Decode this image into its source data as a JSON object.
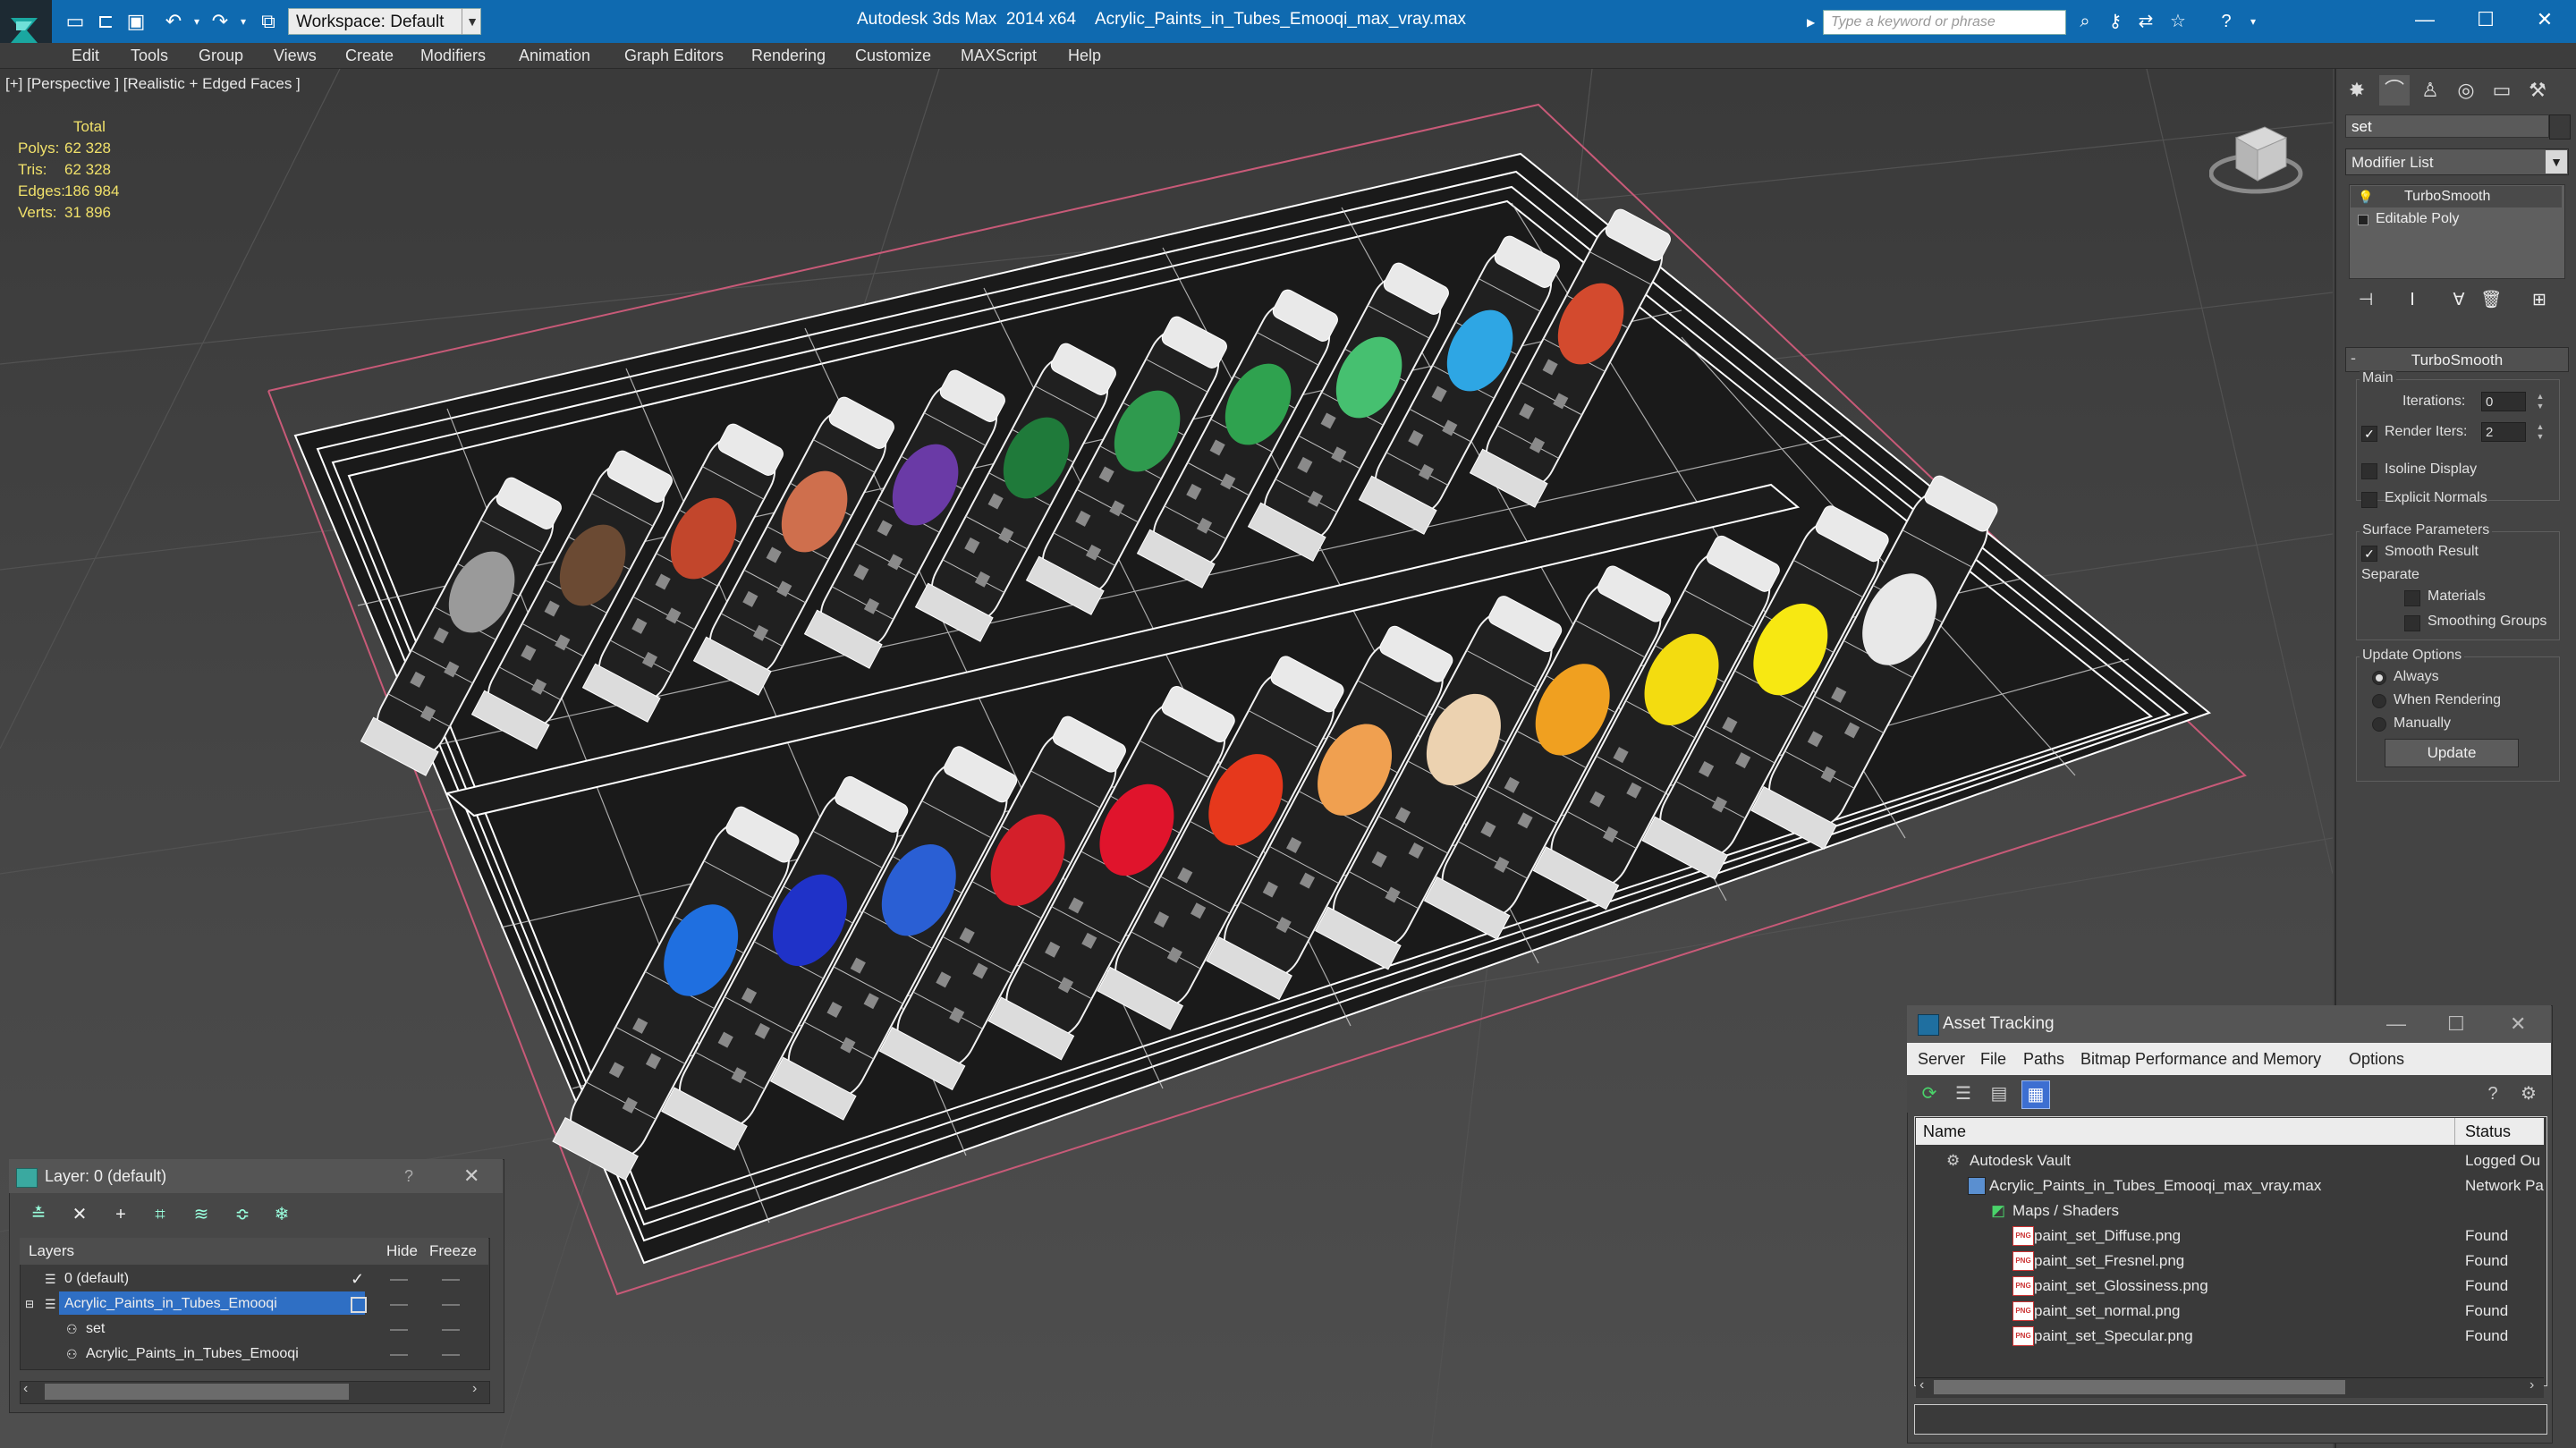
{
  "titlebar": {
    "workspace": "Workspace: Default",
    "app_title": "Autodesk 3ds Max  2014 x64",
    "file_title": "Acrylic_Paints_in_Tubes_Emooqi_max_vray.max",
    "search_placeholder": "Type a keyword or phrase"
  },
  "menu": [
    "Edit",
    "Tools",
    "Group",
    "Views",
    "Create",
    "Modifiers",
    "Animation",
    "Graph Editors",
    "Rendering",
    "Customize",
    "MAXScript",
    "Help"
  ],
  "viewport": {
    "label": "[+] [Perspective ] [Realistic + Edged Faces ]",
    "stats": {
      "header": "Total",
      "rows": [
        {
          "label": "Polys:",
          "value": "62 328"
        },
        {
          "label": "Tris:",
          "value": "62 328"
        },
        {
          "label": "Edges:",
          "value": "186 984"
        },
        {
          "label": "Verts:",
          "value": "31 896"
        }
      ]
    },
    "tube_colors_back": [
      "#9a9a9a",
      "#6b4a33",
      "#c2462c",
      "#cf6f4d",
      "#6a3aa6",
      "#1f7a3a",
      "#2f9a4e",
      "#2fa24f",
      "#46c070",
      "#2ea6e4",
      "#d34a2e"
    ],
    "tube_colors_front": [
      "#1f6fe0",
      "#1f32c8",
      "#2a5fd4",
      "#d41f2a",
      "#e0142c",
      "#e6381c",
      "#f0a050",
      "#ecd2b0",
      "#f0a020",
      "#f3dc10",
      "#f7e812",
      "#e8e8e8"
    ]
  },
  "command_panel": {
    "object_name": "set",
    "modifier_list": "Modifier List",
    "stack": [
      "TurboSmooth",
      "Editable Poly"
    ],
    "rollout_title": "TurboSmooth",
    "main_label": "Main",
    "iterations_label": "Iterations:",
    "iterations_value": "0",
    "render_iters_label": "Render Iters:",
    "render_iters_value": "2",
    "isoline_label": "Isoline Display",
    "explicit_normals_label": "Explicit Normals",
    "surface_params_label": "Surface Parameters",
    "smooth_result_label": "Smooth Result",
    "separate_label": "Separate",
    "materials_label": "Materials",
    "smoothing_groups_label": "Smoothing Groups",
    "update_options_label": "Update Options",
    "always_label": "Always",
    "when_rendering_label": "When Rendering",
    "manually_label": "Manually",
    "update_button": "Update"
  },
  "layer_panel": {
    "title": "Layer: 0 (default)",
    "help": "?",
    "columns": {
      "layers": "Layers",
      "hide": "Hide",
      "freeze": "Freeze"
    },
    "rows": [
      {
        "name": "0 (default)"
      },
      {
        "name": "Acrylic_Paints_in_Tubes_Emooqi"
      },
      {
        "name": "set"
      },
      {
        "name": "Acrylic_Paints_in_Tubes_Emooqi"
      }
    ]
  },
  "asset_tracking": {
    "title": "Asset Tracking",
    "menu": [
      "Server",
      "File",
      "Paths",
      "Bitmap Performance and Memory",
      "Options"
    ],
    "columns": {
      "name": "Name",
      "status": "Status"
    },
    "rows": [
      {
        "name": "Autodesk Vault",
        "status": "Logged Ou"
      },
      {
        "name": "Acrylic_Paints_in_Tubes_Emooqi_max_vray.max",
        "status": "Network Pa"
      },
      {
        "name": "Maps / Shaders",
        "status": ""
      },
      {
        "name": "paint_set_Diffuse.png",
        "status": "Found"
      },
      {
        "name": "paint_set_Fresnel.png",
        "status": "Found"
      },
      {
        "name": "paint_set_Glossiness.png",
        "status": "Found"
      },
      {
        "name": "paint_set_normal.png",
        "status": "Found"
      },
      {
        "name": "paint_set_Specular.png",
        "status": "Found"
      }
    ]
  }
}
